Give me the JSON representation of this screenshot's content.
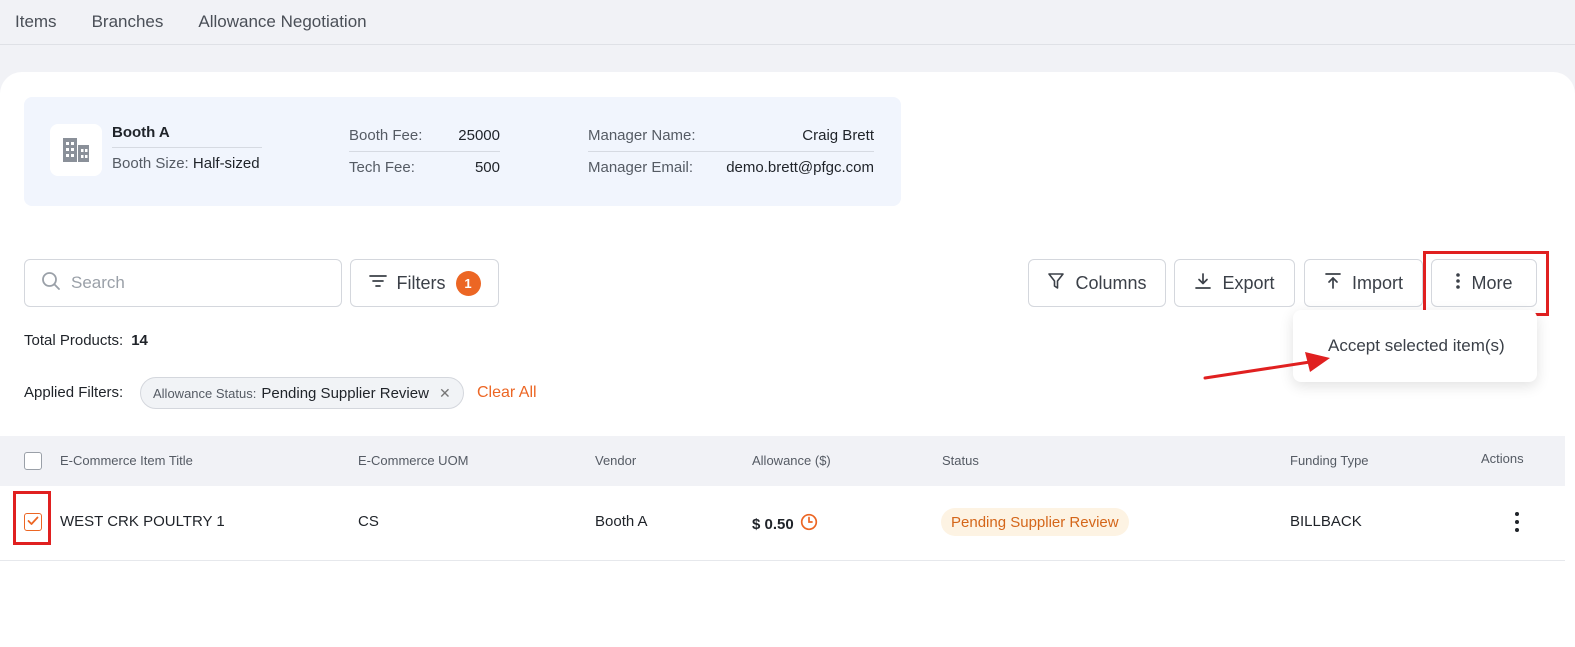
{
  "nav": {
    "tabs": [
      "Items",
      "Branches",
      "Allowance Negotiation"
    ]
  },
  "booth": {
    "name": "Booth A",
    "size_label": "Booth Size:",
    "size_value": "Half-sized",
    "booth_fee_label": "Booth Fee:",
    "booth_fee_value": "25000",
    "tech_fee_label": "Tech Fee:",
    "tech_fee_value": "500",
    "manager_name_label": "Manager Name:",
    "manager_name_value": "Craig Brett",
    "manager_email_label": "Manager Email:",
    "manager_email_value": "demo.brett@pfgc.com"
  },
  "toolbar": {
    "search_placeholder": "Search",
    "filters_label": "Filters",
    "filters_count": "1",
    "columns_label": "Columns",
    "export_label": "Export",
    "import_label": "Import",
    "more_label": "More"
  },
  "more_menu": {
    "items": [
      "Accept selected item(s)"
    ]
  },
  "summary": {
    "total_label": "Total Products:",
    "total_value": "14"
  },
  "filters": {
    "applied_label": "Applied Filters:",
    "chip_key": "Allowance Status:",
    "chip_value": "Pending Supplier Review",
    "clear_all": "Clear All"
  },
  "table": {
    "headers": [
      "E-Commerce Item Title",
      "E-Commerce UOM",
      "Vendor",
      "Allowance ($)",
      "Status",
      "Funding Type",
      "Actions"
    ],
    "rows": [
      {
        "title": "WEST CRK POULTRY 1",
        "uom": "CS",
        "vendor": "Booth A",
        "allowance": "$ 0.50",
        "status": "Pending Supplier Review",
        "funding": "BILLBACK",
        "checked": true
      }
    ]
  },
  "colors": {
    "accent": "#ec6624",
    "highlight": "#e02020",
    "status_bg": "#fdf3e3"
  }
}
